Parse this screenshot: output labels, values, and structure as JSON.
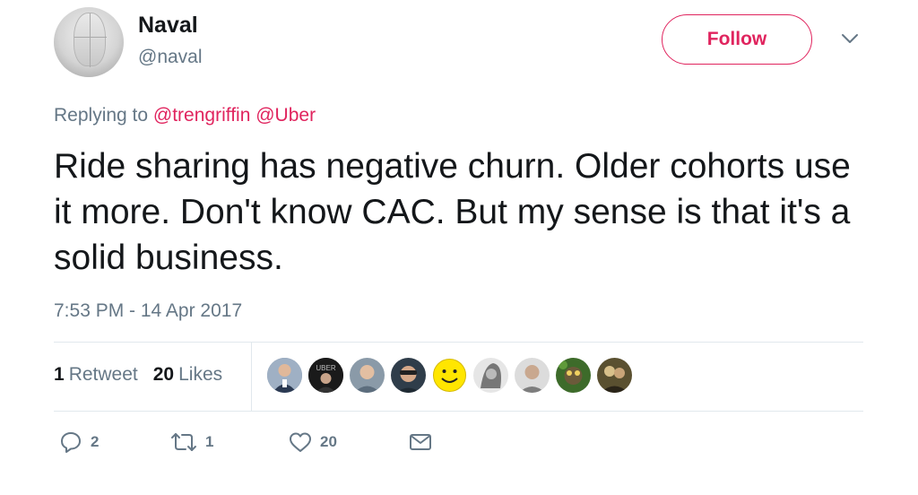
{
  "user": {
    "display_name": "Naval",
    "handle": "@naval",
    "avatar_icon": "profile-photo"
  },
  "follow_button": {
    "label": "Follow",
    "color": "#e0245e"
  },
  "menu_icon": "chevron-down-icon",
  "reply_context": {
    "prefix": "Replying to",
    "mentions": [
      "@trengriffin",
      "@Uber"
    ]
  },
  "tweet": {
    "text": "Ride sharing has negative churn. Older cohorts use it more. Don't know CAC. But my sense is that it's a solid business.",
    "timestamp": "7:53 PM - 14 Apr 2017"
  },
  "stats": {
    "retweets_count": "1",
    "retweets_label": "Retweet",
    "likes_count": "20",
    "likes_label": "Likes"
  },
  "likers": [
    {
      "name": "liker-1",
      "bg": "#6b7f99"
    },
    {
      "name": "liker-uber",
      "bg": "#1a1a1a"
    },
    {
      "name": "liker-3",
      "bg": "#7a8a99"
    },
    {
      "name": "liker-4",
      "bg": "#3a4a5a"
    },
    {
      "name": "liker-smiley",
      "bg": "#ffe600"
    },
    {
      "name": "liker-6",
      "bg": "#e8e8e8"
    },
    {
      "name": "liker-7",
      "bg": "#d8d8d8"
    },
    {
      "name": "liker-8",
      "bg": "#3d6b2a"
    },
    {
      "name": "liker-9",
      "bg": "#5a5030"
    }
  ],
  "actions": {
    "reply_count": "2",
    "retweet_count": "1",
    "like_count": "20",
    "icons": [
      "reply-icon",
      "retweet-icon",
      "like-icon",
      "message-icon"
    ],
    "icon_color": "#657786"
  }
}
